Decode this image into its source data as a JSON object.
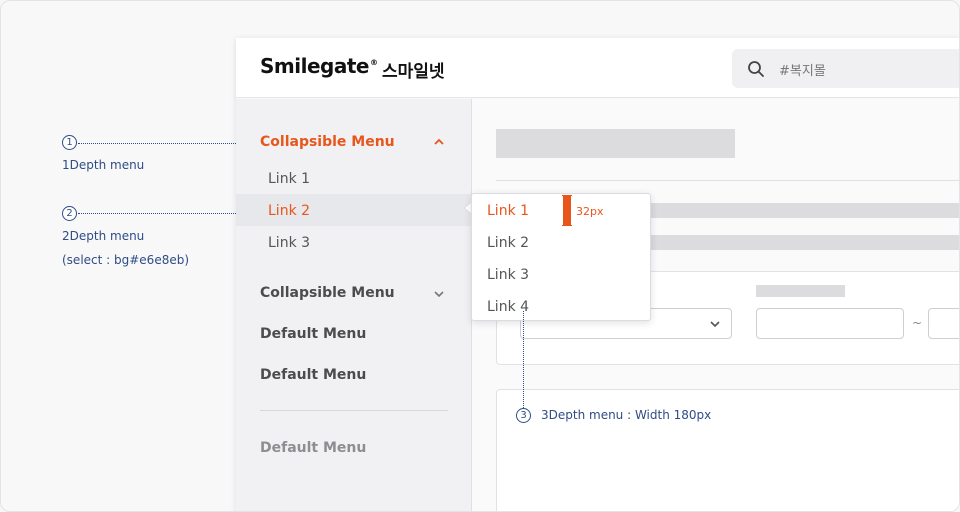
{
  "brand": {
    "name": "Smilegate",
    "mark": "®",
    "korean": "스마일넷"
  },
  "search": {
    "placeholder": "#복지몰"
  },
  "sidebar": {
    "groups": [
      {
        "label": "Collapsible Menu",
        "state": "expanded",
        "links": [
          "Link 1",
          "Link 2",
          "Link 3"
        ],
        "selected": "Link 2"
      },
      {
        "label": "Collapsible Menu",
        "state": "collapsed"
      },
      {
        "label": "Default Menu"
      },
      {
        "label": "Default Menu"
      },
      {
        "label": "Default Menu",
        "state": "disabled"
      }
    ]
  },
  "flyout": {
    "links": [
      "Link 1",
      "Link 2",
      "Link 3",
      "Link 4"
    ],
    "selected": "Link 1"
  },
  "annotations": {
    "one": {
      "num": "1",
      "text": "1Depth menu"
    },
    "two": {
      "num": "2",
      "text": "2Depth menu",
      "text2": "(select : bg#e6e8eb)"
    },
    "three": {
      "num": "3",
      "text": "3Depth menu : Width 180px"
    },
    "measure": "32px"
  },
  "content": {
    "range_separator": "~"
  },
  "colors": {
    "accent": "#e8561c",
    "annotation": "#2f4c86",
    "selected_bg": "#e6e8eb"
  }
}
